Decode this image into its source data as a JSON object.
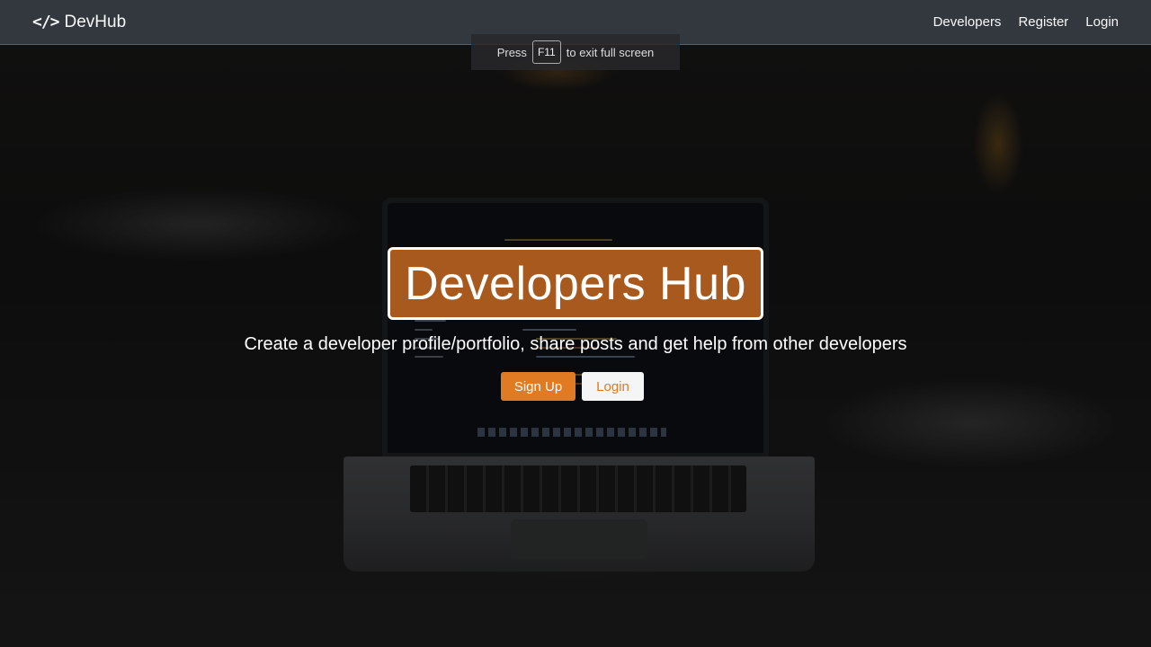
{
  "navbar": {
    "brand_icon": "</>",
    "brand_text": "DevHub",
    "links": [
      "Developers",
      "Register",
      "Login"
    ]
  },
  "fullscreen_notice": {
    "prefix": "Press",
    "key": "F11",
    "suffix": "to exit full screen"
  },
  "hero": {
    "title": "Developers Hub",
    "subtitle": "Create a developer profile/portfolio, share posts and get help from other developers",
    "signup_label": "Sign Up",
    "login_label": "Login"
  },
  "colors": {
    "navbar_bg": "#343a40",
    "title_bg": "#a85a1e",
    "primary": "#e07b24",
    "light": "#f5f5f5"
  },
  "icons": {
    "brand": "code-icon",
    "background": "laptop-photo"
  }
}
